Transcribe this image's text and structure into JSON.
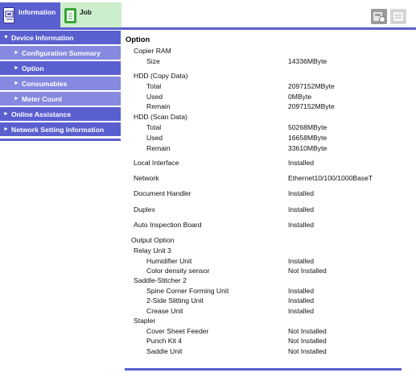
{
  "tabs": {
    "information": "Information",
    "job": "Job"
  },
  "sidebar": {
    "items": [
      {
        "label": "Device Information",
        "arrow": "▼"
      },
      {
        "label": "Configuration Summary",
        "arrow": "►"
      },
      {
        "label": "Option",
        "arrow": "►"
      },
      {
        "label": "Consumables",
        "arrow": "►"
      },
      {
        "label": "Meter Count",
        "arrow": "►"
      },
      {
        "label": "Online Assistance",
        "arrow": "►"
      },
      {
        "label": "Network Setting Information",
        "arrow": "►"
      }
    ],
    "selected": "Option"
  },
  "main": {
    "title": "Option",
    "rows": [
      {
        "key": "Copier RAM",
        "value": ""
      },
      {
        "key": "Size",
        "value": "14336MByte"
      },
      {
        "key": "HDD (Copy Data)",
        "value": ""
      },
      {
        "key": "Total",
        "value": "2097152MByte"
      },
      {
        "key": "Used",
        "value": "0MByte"
      },
      {
        "key": "Remain",
        "value": "2097152MByte"
      },
      {
        "key": "HDD (Scan Data)",
        "value": ""
      },
      {
        "key": "Total",
        "value": "50268MByte"
      },
      {
        "key": "Used",
        "value": "16658MByte"
      },
      {
        "key": "Remain",
        "value": "33610MByte"
      },
      {
        "key": "Local Interface",
        "value": "Installed"
      },
      {
        "key": "Network",
        "value": "Ethernet10/100/1000BaseT"
      },
      {
        "key": "Document Handler",
        "value": "Installed"
      },
      {
        "key": "Duplex",
        "value": "Installed"
      },
      {
        "key": "Auto Inspection Board",
        "value": "Installed"
      },
      {
        "key": "Output Option",
        "value": ""
      },
      {
        "key": "Relay Unit 3",
        "value": ""
      },
      {
        "key": "Humidifier Unit",
        "value": "Installed"
      },
      {
        "key": "Color density sensor",
        "value": "Not Installed"
      },
      {
        "key": "Saddle-Stitcher 2",
        "value": ""
      },
      {
        "key": "Spine Corner Forming Unit",
        "value": "Installed"
      },
      {
        "key": "2-Side Slitting Unit",
        "value": "Installed"
      },
      {
        "key": "Crease Unit",
        "value": "Installed"
      },
      {
        "key": "Stapler",
        "value": ""
      },
      {
        "key": "Cover Sheet Feeder",
        "value": "Not Installed"
      },
      {
        "key": "Punch Kit 4",
        "value": "Not Installed"
      },
      {
        "key": "Saddle Unit",
        "value": "Not Installed"
      }
    ]
  },
  "colors": {
    "accent": "#5a5fd0",
    "sidebar_sub": "#8589e0",
    "job_tab": "#cdeecd",
    "job_icon": "#37a437"
  },
  "icons": {
    "information_tab": "device-info-icon",
    "job_tab": "document-icon",
    "top_right_1": "device-settings-icon",
    "top_right_2": "panel-icon"
  }
}
